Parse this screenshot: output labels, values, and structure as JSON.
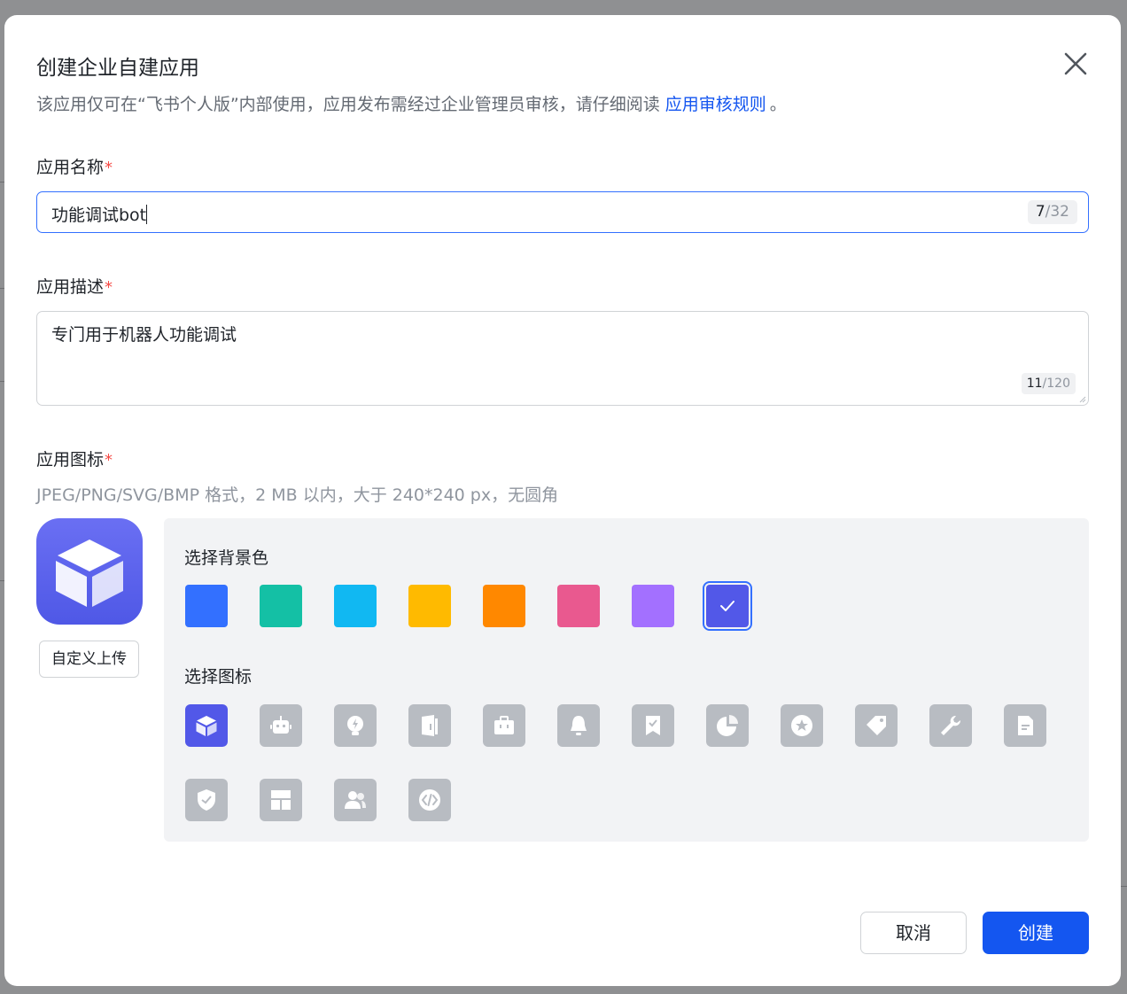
{
  "dialog": {
    "title": "创建企业自建应用",
    "subtitle_text": "该应用仅可在“飞书个人版”内部使用，应用发布需经过企业管理员审核，请仔细阅读",
    "subtitle_link": "应用审核规则",
    "subtitle_tail": "。"
  },
  "fields": {
    "name": {
      "label": "应用名称",
      "required_mark": "*",
      "value": "功能调试bot",
      "count_current": "7",
      "count_max": "/32"
    },
    "description": {
      "label": "应用描述",
      "required_mark": "*",
      "value": "专门用于机器人功能调试",
      "count_current": "11",
      "count_max": "/120"
    },
    "icon": {
      "label": "应用图标",
      "required_mark": "*",
      "hint": "JPEG/PNG/SVG/BMP 格式，2 MB 以内，大于 240*240 px，无圆角"
    }
  },
  "upload_button": "自定义上传",
  "panel": {
    "bg_color_label": "选择背景色",
    "icon_label": "选择图标",
    "bg_colors": [
      "#3370ff",
      "#14c0a5",
      "#11b8f2",
      "#ffba00",
      "#ff8800",
      "#e9598f",
      "#a370ff",
      "#5258e8"
    ],
    "selected_color_index": 7,
    "icons": [
      "cube-icon",
      "robot-icon",
      "lightbulb-icon",
      "book-icon",
      "briefcase-icon",
      "bell-icon",
      "bookmark-check-icon",
      "pie-chart-icon",
      "star-badge-icon",
      "tag-icon",
      "wrench-icon",
      "document-icon",
      "shield-check-icon",
      "layout-icon",
      "people-icon",
      "code-icon"
    ],
    "selected_icon_index": 0
  },
  "buttons": {
    "cancel": "取消",
    "create": "创建"
  },
  "colors": {
    "primary": "#1456f0",
    "required": "#f54a45",
    "icon_tile": "#b8bcc2",
    "selected_bg": "#5258e8"
  }
}
